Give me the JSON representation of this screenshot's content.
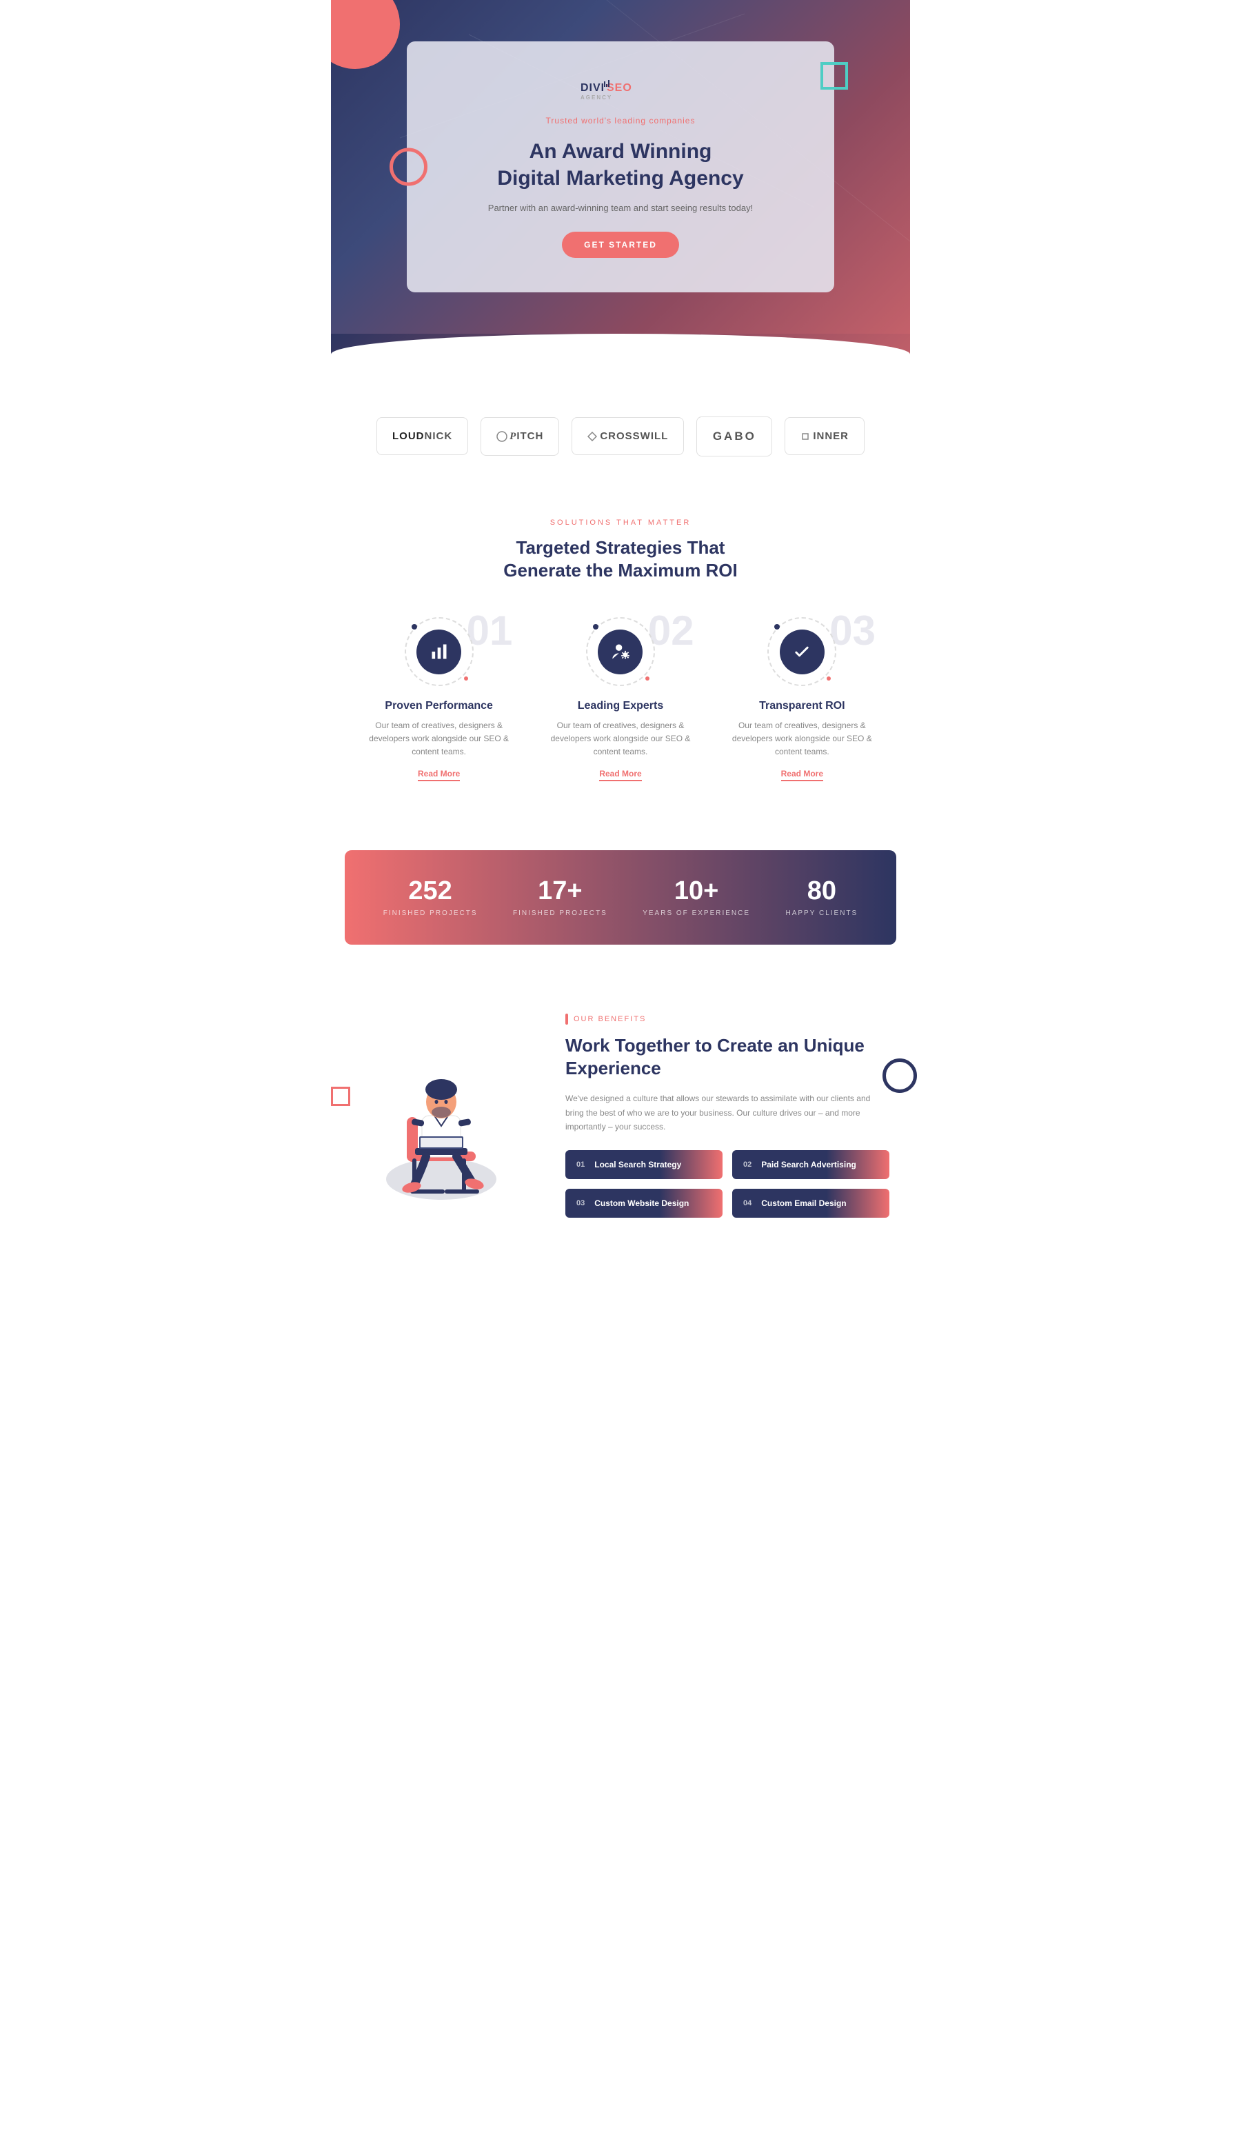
{
  "hero": {
    "logo_main": "DIVI",
    "logo_accent": "SEO",
    "logo_sub": "AGENCY",
    "trusted_text": "Trusted world's leading companies",
    "title_line1": "An Award Winning",
    "title_line2": "Digital Marketing Agency",
    "subtitle": "Partner with an award-winning team and start seeing results today!",
    "cta_label": "GET STARTED"
  },
  "logos": [
    {
      "text": "LOUDNICK",
      "style": "loud"
    },
    {
      "text": "PITCH",
      "style": "pitch"
    },
    {
      "text": "CROSSWILL",
      "style": "cross"
    },
    {
      "text": "GABO",
      "style": "gabo"
    },
    {
      "text": "INNER",
      "style": "inner"
    }
  ],
  "solutions": {
    "tag": "SOLUTIONS THAT MATTER",
    "title_line1": "Targeted Strategies That",
    "title_line2": "Generate the Maximum ROI",
    "cards": [
      {
        "number": "01",
        "icon": "bar-chart",
        "title": "Proven Performance",
        "desc": "Our team of creatives, designers & developers work alongside our SEO & content teams.",
        "link": "Read More"
      },
      {
        "number": "02",
        "icon": "user-settings",
        "title": "Leading Experts",
        "desc": "Our team of creatives, designers & developers work alongside our SEO & content teams.",
        "link": "Read More"
      },
      {
        "number": "03",
        "icon": "check",
        "title": "Transparent ROI",
        "desc": "Our team of creatives, designers & developers work alongside our SEO & content teams.",
        "link": "Read More"
      }
    ]
  },
  "stats": [
    {
      "number": "252",
      "label": "FINISHED PROJECTS"
    },
    {
      "number": "17+",
      "label": "FINISHED PROJECTS"
    },
    {
      "number": "10+",
      "label": "YEARS OF EXPERIENCE"
    },
    {
      "number": "80",
      "label": "HAPPY CLIENTS"
    }
  ],
  "benefits": {
    "tag": "OUR BENEFITS",
    "title": "Work Together to Create an Unique Experience",
    "desc": "We've designed a culture that allows our stewards to assimilate with our clients and bring the best of who we are to your business. Our culture drives our – and more importantly – your success.",
    "items": [
      {
        "num": "01",
        "label": "Local Search Strategy"
      },
      {
        "num": "02",
        "label": "Paid Search Advertising"
      },
      {
        "num": "03",
        "label": "Custom Website Design"
      },
      {
        "num": "04",
        "label": "Custom Email Design"
      }
    ]
  }
}
